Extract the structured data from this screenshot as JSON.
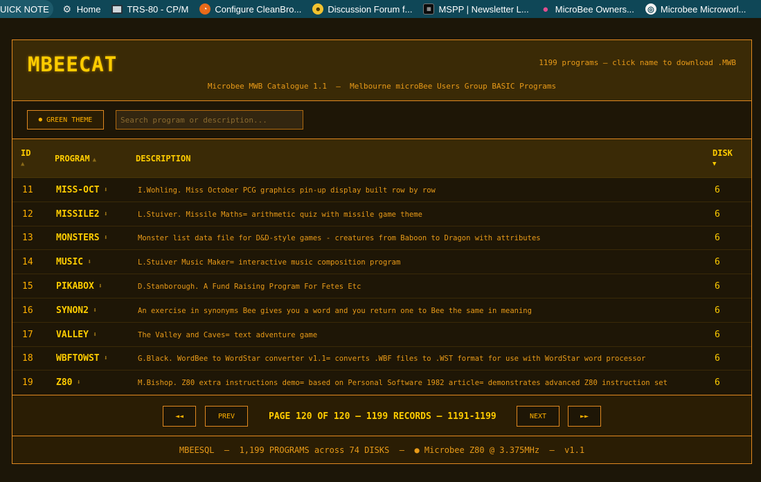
{
  "bookmarks": [
    {
      "label": "UICK NOTE",
      "icon": "none"
    },
    {
      "label": "Home",
      "icon": "gear-icon"
    },
    {
      "label": "TRS-80 - CP/M",
      "icon": "monitor-icon"
    },
    {
      "label": "Configure CleanBro...",
      "icon": "cleanbrowsing-icon"
    },
    {
      "label": "Discussion Forum f...",
      "icon": "bee-icon"
    },
    {
      "label": "MSPP | Newsletter L...",
      "icon": "mspp-icon"
    },
    {
      "label": "MicroBee Owners...",
      "icon": "apple-icon"
    },
    {
      "label": "Microbee Microworl...",
      "icon": "globe-icon"
    }
  ],
  "header": {
    "logo": "MBEECAT",
    "count": "1199 programs — click name to download .MWB",
    "subtitle": "Microbee MWB Catalogue 1.1  —  Melbourne microBee Users Group BASIC Programs"
  },
  "toolbar": {
    "theme_label": "GREEN THEME",
    "search_placeholder": "Search program or description..."
  },
  "columns": {
    "id": "ID",
    "program": "PROGRAM",
    "description": "DESCRIPTION",
    "disk": "DISK"
  },
  "rows": [
    {
      "id": "11",
      "program": "MISS-OCT",
      "description": "I.Wohling. Miss October PCG graphics pin-up display built row by row",
      "disk": "6"
    },
    {
      "id": "12",
      "program": "MISSILE2",
      "description": "L.Stuiver. Missile Maths= arithmetic quiz with missile game theme",
      "disk": "6"
    },
    {
      "id": "13",
      "program": "MONSTERS",
      "description": "Monster list data file for D&D-style games - creatures from Baboon to Dragon with attributes",
      "disk": "6"
    },
    {
      "id": "14",
      "program": "MUSIC",
      "description": "L.Stuiver Music Maker= interactive music composition program",
      "disk": "6"
    },
    {
      "id": "15",
      "program": "PIKABOX",
      "description": "D.Stanborough. A Fund Raising Program For Fetes Etc",
      "disk": "6"
    },
    {
      "id": "16",
      "program": "SYNON2",
      "description": "An exercise in synonyms Bee gives you a word and you return one to Bee the same in meaning",
      "disk": "6"
    },
    {
      "id": "17",
      "program": "VALLEY",
      "description": "The Valley and Caves= text adventure game",
      "disk": "6"
    },
    {
      "id": "18",
      "program": "WBFTOWST",
      "description": "G.Black. WordBee to WordStar converter v1.1= converts .WBF files to .WST format for use with WordStar word processor",
      "disk": "6"
    },
    {
      "id": "19",
      "program": "Z80",
      "description": "M.Bishop. Z80 extra instructions demo= based on Personal Software 1982 article= demonstrates advanced Z80 instruction set",
      "disk": "6"
    }
  ],
  "pager": {
    "first": "◄◄",
    "prev": "PREV",
    "info": "PAGE 120 OF 120 — 1199 RECORDS — 1191-1199",
    "next": "NEXT",
    "last": "►►"
  },
  "footer": {
    "text": "MBEESQL  —  1,199 PROGRAMS across 74 DISKS  —  ● Microbee Z80 @ 3.375MHz  —  v1.1"
  },
  "colors": {
    "amber": "#ffb000",
    "accent": "#e08820",
    "background": "#1c1608",
    "bookmark_bar": "#0f4757"
  }
}
